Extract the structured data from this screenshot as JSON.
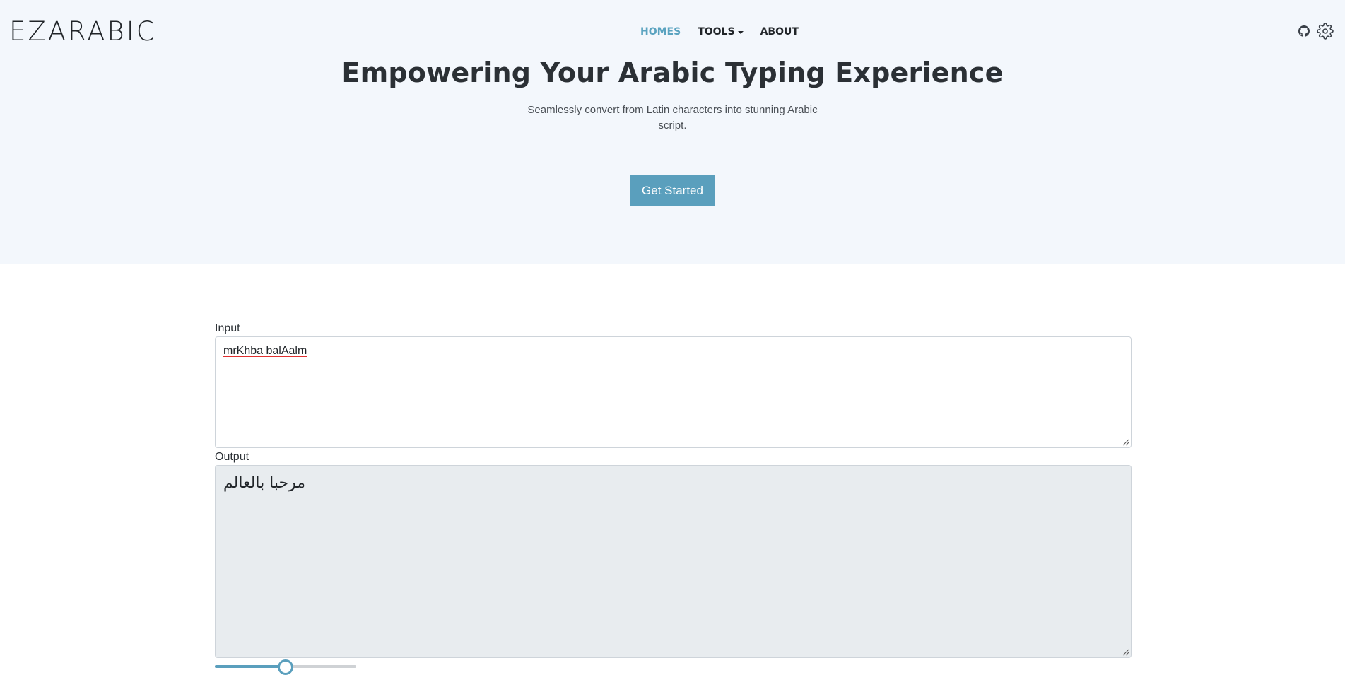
{
  "brand": "EZARABIC",
  "nav": {
    "items": [
      {
        "label": "HOMES",
        "active": true
      },
      {
        "label": "TOOLS",
        "has_dropdown": true
      },
      {
        "label": "ABOUT"
      }
    ],
    "icons": [
      "github-icon",
      "gear-icon"
    ]
  },
  "hero": {
    "title": "Empowering Your Arabic Typing Experience",
    "subtitle": "Seamlessly convert from Latin characters into stunning Arabic script.",
    "cta_label": "Get Started"
  },
  "converter": {
    "input_label": "Input",
    "input_value": "mrKhba balAalm",
    "output_label": "Output",
    "output_value": "مرحبا بالعالم",
    "slider_value": 0.5
  },
  "colors": {
    "accent": "#5a9fbd",
    "hero_bg": "#f3f7fc",
    "output_bg": "#e8ecef"
  }
}
